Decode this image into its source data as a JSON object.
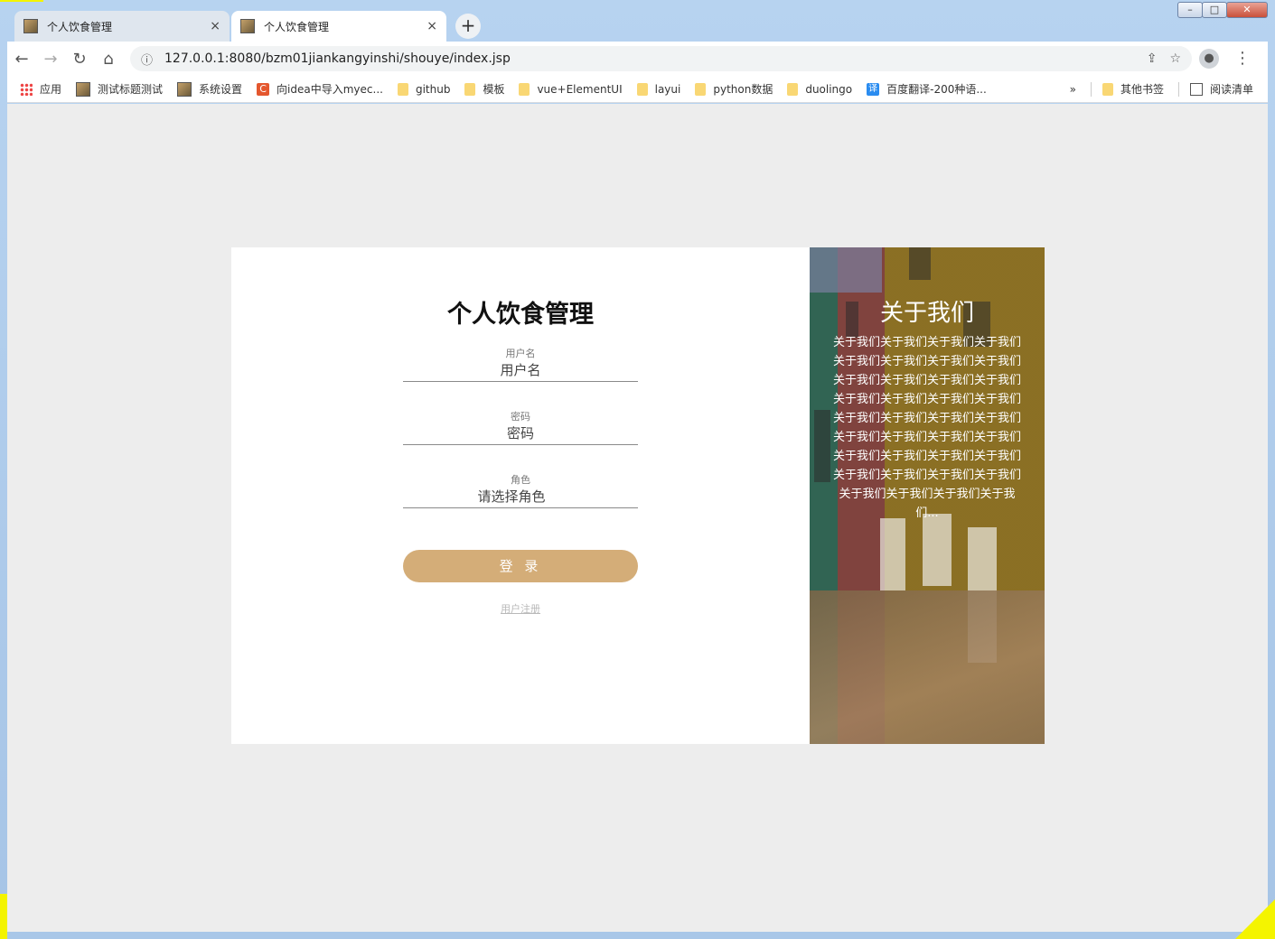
{
  "browser": {
    "tabs": [
      {
        "title": "个人饮食管理",
        "close": "×"
      },
      {
        "title": "个人饮食管理",
        "close": "×"
      }
    ],
    "new_tab": "+",
    "url": "127.0.0.1:8080/bzm01jiankangyinshi/shouye/index.jsp",
    "bookmarks": [
      "应用",
      "测试标题测试",
      "系统设置",
      "向idea中导入myec...",
      "github",
      "模板",
      "vue+ElementUI",
      "layui",
      "python数据",
      "duolingo",
      "百度翻译-200种语..."
    ],
    "bookmarks_more": "»",
    "other_bookmarks": "其他书签",
    "reading_list": "阅读清单"
  },
  "login": {
    "title": "个人饮食管理",
    "username_label": "用户名",
    "username_placeholder": "用户名",
    "password_label": "密码",
    "password_placeholder": "密码",
    "role_label": "角色",
    "role_placeholder": "请选择角色",
    "login_button": "登 录",
    "register_link": "用户注册"
  },
  "about": {
    "title": "关于我们",
    "text": "关于我们关于我们关于我们关于我们关于我们关于我们关于我们关于我们关于我们关于我们关于我们关于我们关于我们关于我们关于我们关于我们关于我们关于我们关于我们关于我们关于我们关于我们关于我们关于我们关于我们关于我们关于我们关于我们关于我们关于我们关于我们关于我们关于我们关于我们关于我们关于我们关于我们关于我们关于我们关于我们关于我们关于我们关于我们关于我们关于我们关于我们关于我们关于我们关于我们关于我们关于我们关于我们关于我们关于我们关于我们关于我们关于我们关于我们关于我们关于我们关于我们关于我们关于我们关于我们关于我们关于我们关于我们关于我们关于我们关于我们关于我们关于我们关于我们关于我们关于我们关于我们关于我们关于我们关于我们关于我们关于我们关于我们关于我们关于我们关于我们关于我们关于我们关于我们关于我们关于我们关于我们关于我们关于我们关于我们关于我们关于我们关于我们关于我们关于我们关于我们关于我们关于我们关于我们关于我们关于我们..."
  },
  "about_display_text": "关于我们关于我们关于我们关于我们关于我们关于我们关于我们关于我们关于我们关于我们关于我们关于我们关于我们关于我们关于我们关于我们关于我们关于我们关于我们关于我们关于我们关于我们关于我们关于我们关于我们关于我们关于我们关于我们关于我们关于我们关于我们关于我们关于我们关于我们关于我们关于我们..."
}
